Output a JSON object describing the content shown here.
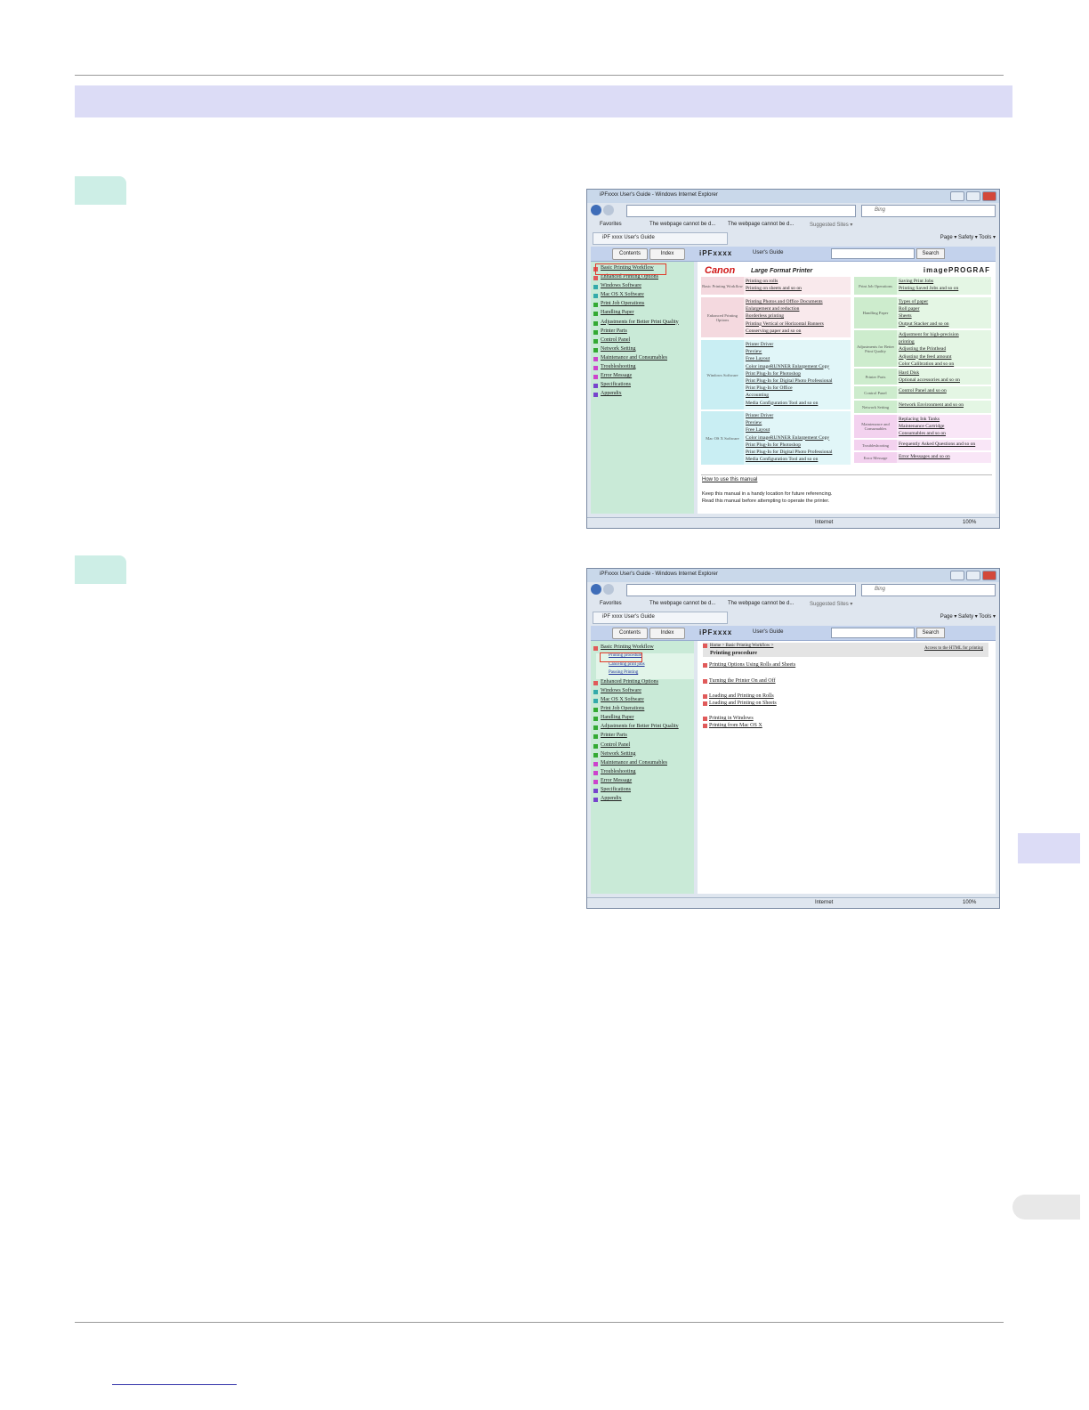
{
  "window_title": "iPFxxxx  User's Guide - Windows Internet Explorer",
  "search_placeholder": "Bing",
  "favbar": {
    "favorites": "Favorites",
    "tab_a": "The webpage cannot be d...",
    "tab_b": "The webpage cannot be d...",
    "suggested": "Suggested Sites ▾"
  },
  "page_tab": "iPF xxxx  User's Guide",
  "commands": "Page ▾  Safety ▾  Tools ▾",
  "header": {
    "contents": "Contents",
    "index": "Index",
    "brand": "iPFxxxx",
    "guide": "User's Guide",
    "search": "Search"
  },
  "sidebar": [
    {
      "label": "Basic Printing Workflow",
      "color": "#e05a5a"
    },
    {
      "label": "Enhanced Printing Options",
      "color": "#e05a5a"
    },
    {
      "label": "Windows Software",
      "color": "#33aaaa"
    },
    {
      "label": "Mac OS X Software",
      "color": "#33aaaa"
    },
    {
      "label": "Print Job Operations",
      "color": "#33aa33"
    },
    {
      "label": "Handling Paper",
      "color": "#33aa33"
    },
    {
      "label": "Adjustments for Better Print Quality",
      "color": "#33aa33"
    },
    {
      "label": "Printer Parts",
      "color": "#33aa33"
    },
    {
      "label": "Control Panel",
      "color": "#33aa33"
    },
    {
      "label": "Network Setting",
      "color": "#33aa33"
    },
    {
      "label": "Maintenance and Consumables",
      "color": "#cc44cc"
    },
    {
      "label": "Troubleshooting",
      "color": "#cc44cc"
    },
    {
      "label": "Error Message",
      "color": "#cc44cc"
    },
    {
      "label": "Specifications",
      "color": "#7744cc"
    },
    {
      "label": "Appendix",
      "color": "#7744cc"
    }
  ],
  "home": {
    "canon": "Canon",
    "lfp": "Large Format Printer",
    "imageprograf": "imagePROGRAF",
    "left_cells": [
      {
        "label": "Basic Printing Workflow",
        "items": [
          "Printing on rolls",
          "Printing on sheets  and so on"
        ]
      },
      {
        "label": "Enhanced Printing Options",
        "items": [
          "Printing Photos and Office Documents",
          "Enlargement and reduction",
          "Borderless printing",
          "Printing Vertical or Horizontal Banners",
          "Conserving paper  and so on"
        ]
      },
      {
        "label": "Windows Software",
        "items": [
          "Printer Driver",
          "Preview",
          "Free Layout",
          "Color imageRUNNER Enlargement Copy",
          "Print Plug-In for Photoshop",
          "Print Plug-In for Digital Photo Professional",
          "Print Plug-In for Office",
          "Accounting",
          "Media Configuration Tool  and so on"
        ]
      },
      {
        "label": "Mac OS X Software",
        "items": [
          "Printer Driver",
          "Preview",
          "Free Layout",
          "Color imageRUNNER Enlargement Copy",
          "Print Plug-In for Photoshop",
          "Print Plug-In for Digital Photo Professional",
          "Media Configuration Tool  and so on"
        ]
      }
    ],
    "right_cells": [
      {
        "label": "Print Job Operations",
        "items": [
          "Saving Print Jobs",
          "Printing Saved Jobs  and so on"
        ]
      },
      {
        "label": "Handling Paper",
        "items": [
          "Types of paper",
          "Roll paper",
          "Sheets",
          "Output Stacker  and so on"
        ]
      },
      {
        "label": "Adjustments for Better Print Quality",
        "items": [
          "Adjustment for high-precision",
          "printing",
          "Adjusting the Printhead",
          "Adjusting the feed amount",
          "Color Calibration  and so on"
        ]
      },
      {
        "label": "Printer Parts",
        "items": [
          "Hard Disk",
          "Optional accessories  and so on"
        ]
      },
      {
        "label": "Control Panel",
        "items": [
          "Control Panel  and so on"
        ]
      },
      {
        "label": "Network Setting",
        "items": [
          "Network Environment  and so on"
        ]
      },
      {
        "label": "Maintenance and Consumables",
        "items": [
          "Replacing Ink Tanks",
          "Maintenance Cartridge",
          "Consumables  and so on"
        ]
      },
      {
        "label": "Troubleshooting",
        "items": [
          "Frequently Asked Questions  and so on"
        ]
      },
      {
        "label": "Error Message",
        "items": [
          "Error Messages  and so on"
        ]
      }
    ],
    "how_to": "How to use this manual",
    "note1": "Keep this manual in a handy location for future referencing.",
    "note2": "Read this manual before attempting to operate the printer."
  },
  "sidebar2_sub": [
    "Printing procedure",
    "Canceling print jobs",
    "Pausing Printing"
  ],
  "page2": {
    "crumb": "Home > Basic Printing Workflow >",
    "title": "Printing procedure",
    "access": "Access to the HTML for printing",
    "links": [
      "Printing Options Using Rolls and Sheets",
      "Turning the Printer On and Off",
      "Loading and Printing on Rolls",
      "Loading and Printing on Sheets",
      "Printing in Windows",
      "Printing from Mac OS X"
    ]
  },
  "status": {
    "zone": "Internet",
    "zoom": "100%"
  }
}
